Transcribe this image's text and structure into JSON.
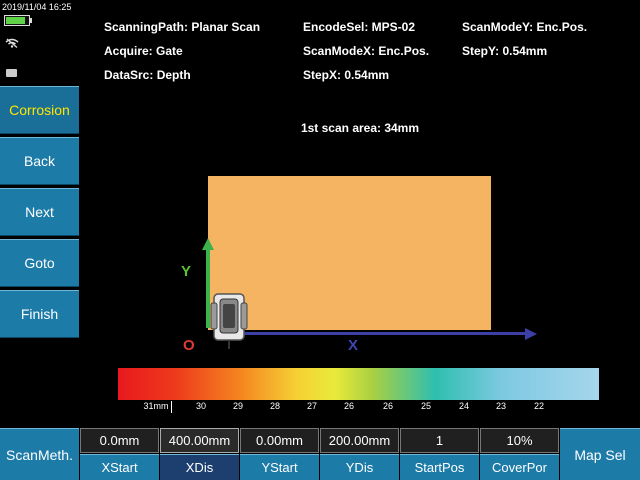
{
  "status": {
    "datetime": "2019/11/04  16:25",
    "battery_level": 0.85
  },
  "sidebar": {
    "items": [
      {
        "label": "Corrosion",
        "active": true
      },
      {
        "label": "Back"
      },
      {
        "label": "Next"
      },
      {
        "label": "Goto"
      },
      {
        "label": "Finish"
      }
    ]
  },
  "info": {
    "scanning_path": "ScanningPath: Planar Scan",
    "acquire": "Acquire: Gate",
    "data_src": "DataSrc: Depth",
    "encode_sel": "EncodeSel: MPS-02",
    "scan_mode_x": "ScanModeX: Enc.Pos.",
    "step_x": "StepX: 0.54mm",
    "scan_mode_y": "ScanModeY: Enc.Pos.",
    "step_y": "StepY: 0.54mm"
  },
  "scan": {
    "title": "1st scan area: 34mm",
    "y_label": "Y",
    "x_label": "X",
    "origin_label": "O"
  },
  "colorbar": {
    "ticks": [
      "31mm",
      "30",
      "29",
      "28",
      "27",
      "26",
      "26",
      "25",
      "24",
      "23",
      "22"
    ],
    "colors": [
      "#e8191e",
      "#f4831f",
      "#e9ea3a",
      "#2ebfb0",
      "#a5d6ed"
    ]
  },
  "toolbar": {
    "scan_method": "ScanMeth.",
    "map_sel": "Map Sel",
    "params": [
      {
        "value": "0.0mm",
        "label": "XStart"
      },
      {
        "value": "400.00mm",
        "label": "XDis",
        "selected": true
      },
      {
        "value": "0.00mm",
        "label": "YStart"
      },
      {
        "value": "200.00mm",
        "label": "YDis"
      },
      {
        "value": "1",
        "label": "StartPos"
      },
      {
        "value": "10%",
        "label": "CoverPor"
      }
    ]
  },
  "icons": {
    "battery": "battery-icon",
    "wifi": "wifi-off-icon",
    "card": "sd-card-icon",
    "scanner": "scanner-icon"
  }
}
